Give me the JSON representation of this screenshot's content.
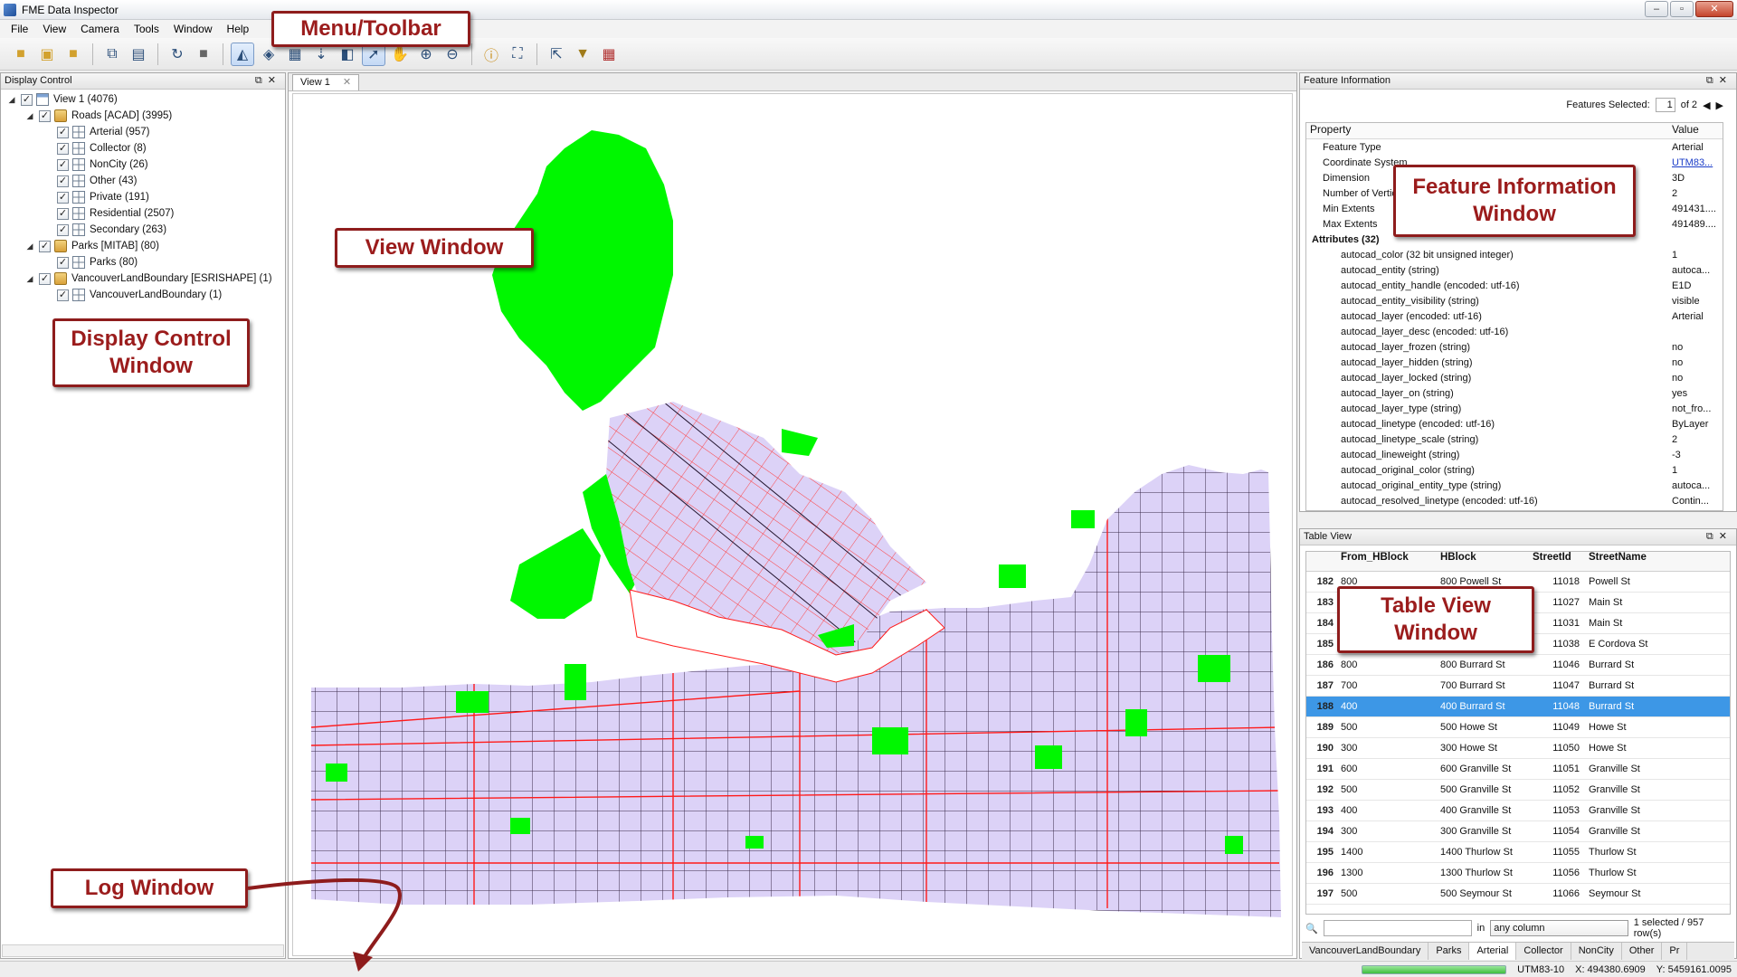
{
  "window": {
    "title": "FME Data Inspector"
  },
  "menu": [
    "File",
    "View",
    "Camera",
    "Tools",
    "Window",
    "Help"
  ],
  "toolbar_icons": [
    "open-icon",
    "add-dataset-icon",
    "folder-icon",
    "copy-icon",
    "save-icon",
    "refresh-icon",
    "stop-icon",
    "select-icon",
    "3d-view-icon",
    "table-icon",
    "import-icon",
    "layer-icon",
    "pointer-icon",
    "pan-icon",
    "zoom-in-icon",
    "zoom-out-icon",
    "inspect-icon",
    "extent-icon",
    "select-tool-icon",
    "filter-icon",
    "grid-icon"
  ],
  "display_control": {
    "title": "Display Control",
    "tree": [
      {
        "label": "View 1 (4076)",
        "level": 0,
        "arrow": "◢",
        "icon": "view"
      },
      {
        "label": "Roads [ACAD] (3995)",
        "level": 1,
        "arrow": "◢",
        "icon": "db"
      },
      {
        "label": "Arterial (957)",
        "level": 2,
        "icon": "grid"
      },
      {
        "label": "Collector (8)",
        "level": 2,
        "icon": "grid"
      },
      {
        "label": "NonCity (26)",
        "level": 2,
        "icon": "grid"
      },
      {
        "label": "Other (43)",
        "level": 2,
        "icon": "grid"
      },
      {
        "label": "Private (191)",
        "level": 2,
        "icon": "grid"
      },
      {
        "label": "Residential (2507)",
        "level": 2,
        "icon": "grid"
      },
      {
        "label": "Secondary (263)",
        "level": 2,
        "icon": "grid"
      },
      {
        "label": "Parks [MITAB] (80)",
        "level": 1,
        "arrow": "◢",
        "icon": "db"
      },
      {
        "label": "Parks (80)",
        "level": 2,
        "icon": "grid"
      },
      {
        "label": "VancouverLandBoundary [ESRISHAPE] (1)",
        "level": 1,
        "arrow": "◢",
        "icon": "db"
      },
      {
        "label": "VancouverLandBoundary (1)",
        "level": 2,
        "icon": "grid"
      }
    ]
  },
  "view": {
    "tab_label": "View 1",
    "close": "✕"
  },
  "feature_info": {
    "title": "Feature Information",
    "features_selected_label": "Features Selected:",
    "page": "1",
    "of": "of 2",
    "col_property": "Property",
    "col_value": "Value",
    "rows": [
      {
        "p": "Feature Type",
        "v": "Arterial"
      },
      {
        "p": "Coordinate System",
        "v": "UTM83..."
      },
      {
        "p": "Dimension",
        "v": "3D"
      },
      {
        "p": "Number of Vertices",
        "v": "2"
      },
      {
        "p": "Min Extents",
        "v": "491431...."
      },
      {
        "p": "Max Extents",
        "v": "491489...."
      }
    ],
    "attributes_label": "Attributes (32)",
    "attributes": [
      {
        "p": "autocad_color (32 bit unsigned integer)",
        "v": "1"
      },
      {
        "p": "autocad_entity (string)",
        "v": "autoca..."
      },
      {
        "p": "autocad_entity_handle (encoded: utf-16)",
        "v": "E1D"
      },
      {
        "p": "autocad_entity_visibility (string)",
        "v": "visible"
      },
      {
        "p": "autocad_layer (encoded: utf-16)",
        "v": "Arterial"
      },
      {
        "p": "autocad_layer_desc (encoded: utf-16)",
        "v": ""
      },
      {
        "p": "autocad_layer_frozen (string)",
        "v": "no"
      },
      {
        "p": "autocad_layer_hidden (string)",
        "v": "no"
      },
      {
        "p": "autocad_layer_locked (string)",
        "v": "no"
      },
      {
        "p": "autocad_layer_on (string)",
        "v": "yes"
      },
      {
        "p": "autocad_layer_type (string)",
        "v": "not_fro..."
      },
      {
        "p": "autocad_linetype (encoded: utf-16)",
        "v": "ByLayer"
      },
      {
        "p": "autocad_linetype_scale (string)",
        "v": "2"
      },
      {
        "p": "autocad_lineweight (string)",
        "v": "-3"
      },
      {
        "p": "autocad_original_color (string)",
        "v": "1"
      },
      {
        "p": "autocad_original_entity_type (string)",
        "v": "autoca..."
      },
      {
        "p": "autocad_resolved_linetype (encoded: utf-16)",
        "v": "Contin..."
      }
    ]
  },
  "table_view": {
    "title": "Table View",
    "columns": [
      "From_HBlock",
      "HBlock",
      "StreetId",
      "StreetName"
    ],
    "rows": [
      {
        "n": "182",
        "a": "800",
        "b": "800 Powell St",
        "c": "11018",
        "d": "Powell St"
      },
      {
        "n": "183",
        "a": "",
        "b": "",
        "c": "11027",
        "d": "Main St"
      },
      {
        "n": "184",
        "a": "",
        "b": "",
        "c": "11031",
        "d": "Main St"
      },
      {
        "n": "185",
        "a": "",
        "b": "",
        "c": "11038",
        "d": "E Cordova St"
      },
      {
        "n": "186",
        "a": "800",
        "b": "800 Burrard St",
        "c": "11046",
        "d": "Burrard St"
      },
      {
        "n": "187",
        "a": "700",
        "b": "700 Burrard St",
        "c": "11047",
        "d": "Burrard St"
      },
      {
        "n": "188",
        "a": "400",
        "b": "400 Burrard St",
        "c": "11048",
        "d": "Burrard St",
        "selected": true
      },
      {
        "n": "189",
        "a": "500",
        "b": "500 Howe St",
        "c": "11049",
        "d": "Howe St"
      },
      {
        "n": "190",
        "a": "300",
        "b": "300 Howe St",
        "c": "11050",
        "d": "Howe St"
      },
      {
        "n": "191",
        "a": "600",
        "b": "600 Granville St",
        "c": "11051",
        "d": "Granville St"
      },
      {
        "n": "192",
        "a": "500",
        "b": "500 Granville St",
        "c": "11052",
        "d": "Granville St"
      },
      {
        "n": "193",
        "a": "400",
        "b": "400 Granville St",
        "c": "11053",
        "d": "Granville St"
      },
      {
        "n": "194",
        "a": "300",
        "b": "300 Granville St",
        "c": "11054",
        "d": "Granville St"
      },
      {
        "n": "195",
        "a": "1400",
        "b": "1400 Thurlow St",
        "c": "11055",
        "d": "Thurlow St"
      },
      {
        "n": "196",
        "a": "1300",
        "b": "1300 Thurlow St",
        "c": "11056",
        "d": "Thurlow St"
      },
      {
        "n": "197",
        "a": "500",
        "b": "500 Seymour St",
        "c": "11066",
        "d": "Seymour St"
      }
    ],
    "filter_in": "in",
    "filter_select": "any column",
    "selected_info": "1 selected / 957 row(s)",
    "tabs": [
      "VancouverLandBoundary",
      "Parks",
      "Arterial",
      "Collector",
      "NonCity",
      "Other",
      "Pr"
    ],
    "active_tab": "Arterial"
  },
  "status": {
    "crs": "UTM83-10",
    "x": "X:  494380.6909",
    "y": "Y:  5459161.0095"
  },
  "annotations": {
    "menu_toolbar": "Menu/Toolbar",
    "view_window": "View Window",
    "display_control": "Display Control\nWindow",
    "feature_info": "Feature Information\nWindow",
    "table_view": "Table View\nWindow",
    "log_window": "Log Window"
  },
  "colors": {
    "park": "#00f700",
    "land": "#d9cff7",
    "arterial": "#ff1a1a",
    "residential": "#3a2a4a",
    "annotation": "#9b1c1c",
    "selection": "#3d97e6"
  }
}
